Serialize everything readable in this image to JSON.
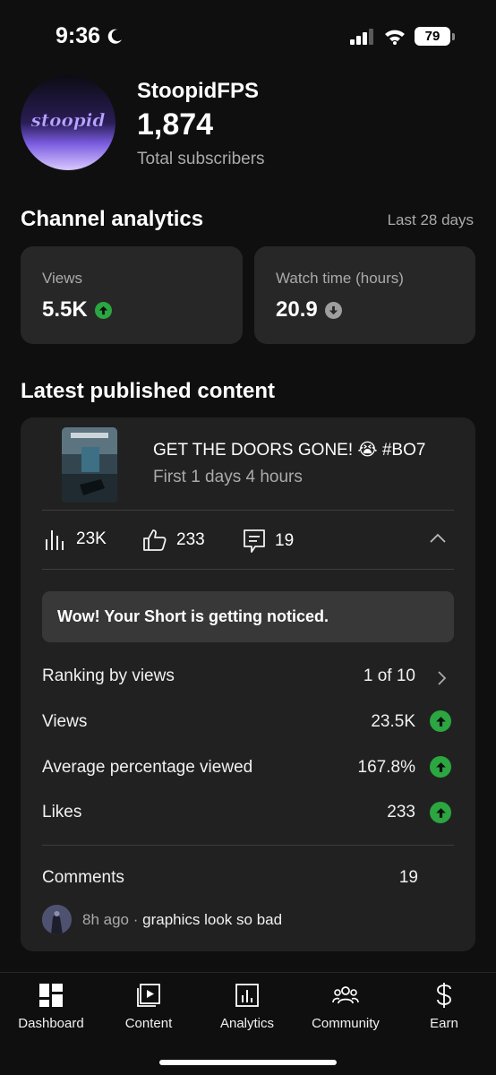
{
  "status_bar": {
    "time": "9:36",
    "battery": "79"
  },
  "channel": {
    "name": "StoopidFPS",
    "avatar_text": "stoopid",
    "subscribers": "1,874",
    "subscribers_label": "Total subscribers"
  },
  "analytics": {
    "title": "Channel analytics",
    "range": "Last 28 days",
    "cards": [
      {
        "label": "Views",
        "value": "5.5K",
        "trend": "up"
      },
      {
        "label": "Watch time (hours)",
        "value": "20.9",
        "trend": "down"
      }
    ]
  },
  "latest": {
    "title": "Latest published content",
    "video": {
      "title": "GET THE DOORS GONE! 😭 #BO7",
      "subtitle": "First 1 days 4 hours"
    },
    "metrics": {
      "views": "23K",
      "likes": "233",
      "comments": "19"
    },
    "notice": "Wow! Your Short is getting noticed.",
    "rows": [
      {
        "label": "Ranking by views",
        "value": "1 of 10",
        "icon": "chevron-right-icon"
      },
      {
        "label": "Views",
        "value": "23.5K",
        "icon": "arrow-up-icon"
      },
      {
        "label": "Average percentage viewed",
        "value": "167.8%",
        "icon": "arrow-up-icon"
      },
      {
        "label": "Likes",
        "value": "233",
        "icon": "arrow-up-icon"
      }
    ],
    "comments": {
      "label": "Comments",
      "count": "19",
      "time": "8h ago",
      "separator": "·",
      "text": "graphics look so bad"
    }
  },
  "nav": [
    {
      "label": "Dashboard",
      "icon": "dashboard-icon"
    },
    {
      "label": "Content",
      "icon": "content-icon"
    },
    {
      "label": "Analytics",
      "icon": "analytics-icon"
    },
    {
      "label": "Community",
      "icon": "community-icon"
    },
    {
      "label": "Earn",
      "icon": "dollar-icon"
    }
  ],
  "colors": {
    "up": "#2ba640",
    "down": "#9e9e9e",
    "card": "#272727",
    "background": "#0f0f0f"
  }
}
